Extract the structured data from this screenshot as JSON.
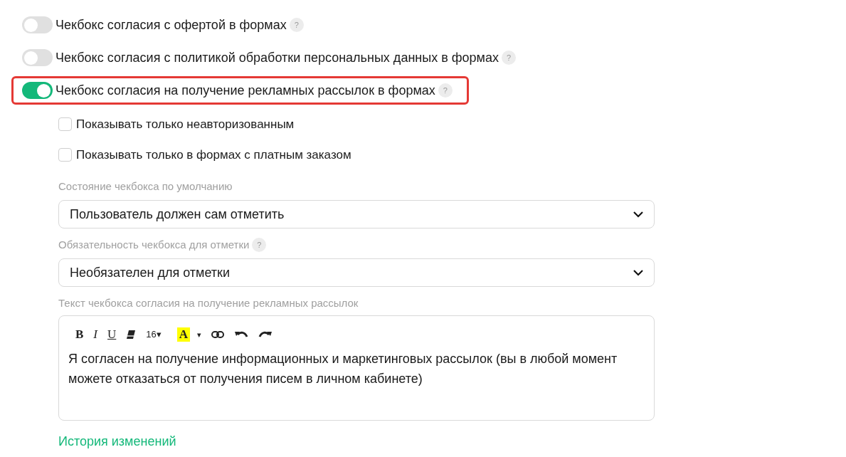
{
  "toggles": [
    {
      "label": "Чекбокс согласия с офертой в формах",
      "on": false,
      "highlighted": false,
      "help": "?"
    },
    {
      "label": "Чекбокс согласия с политикой обработки персональных данных в формах",
      "on": false,
      "highlighted": false,
      "help": "?"
    },
    {
      "label": "Чекбокс согласия на получение рекламных рассылок в формах",
      "on": true,
      "highlighted": true,
      "help": "?"
    }
  ],
  "checkboxes": [
    {
      "label": "Показывать только неавторизованным",
      "checked": false
    },
    {
      "label": "Показывать только в формах с платным заказом",
      "checked": false
    }
  ],
  "selects": [
    {
      "label": "Состояние чекбокса по умолчанию",
      "value": "Пользователь должен сам отметить"
    },
    {
      "label": "Обязательность чекбокса для отметки",
      "help": "?",
      "value": "Необязателен для отметки"
    }
  ],
  "editor": {
    "label": "Текст чекбокса согласия на получение рекламных рассылок",
    "toolbar": [
      {
        "kind": "bold",
        "text": "B"
      },
      {
        "kind": "italic",
        "text": "I"
      },
      {
        "kind": "underline",
        "text": "U"
      },
      {
        "kind": "eraser"
      },
      {
        "kind": "size",
        "text": "16▾"
      },
      {
        "kind": "color",
        "text": "A"
      },
      {
        "kind": "caret",
        "text": "▾"
      },
      {
        "kind": "link"
      },
      {
        "kind": "undo"
      },
      {
        "kind": "redo"
      }
    ],
    "text": "Я согласен на получение информационных и маркетинговых рассылок (вы в любой момент можете отказаться от получения писем в личном кабинете)"
  },
  "history_link": "История изменений"
}
